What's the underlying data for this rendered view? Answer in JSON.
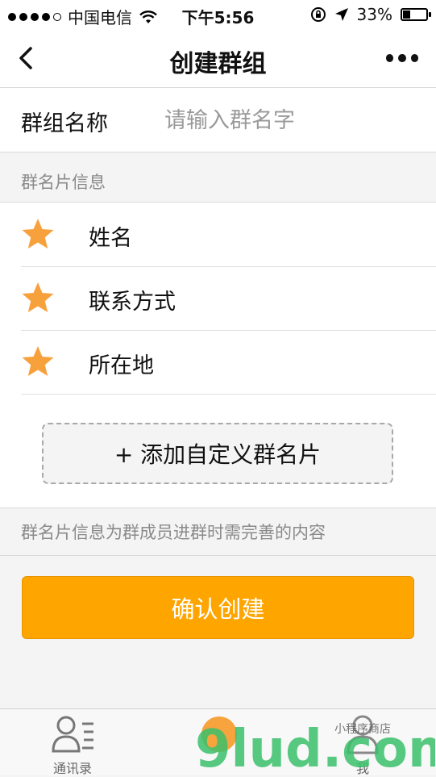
{
  "status_bar": {
    "carrier": "中国电信",
    "time": "下午5:56",
    "battery_percent": "33%",
    "battery_level": 0.33
  },
  "nav": {
    "title": "创建群组"
  },
  "group_name": {
    "label": "群组名称",
    "placeholder": "请输入群名字",
    "value": ""
  },
  "card_section": {
    "header": "群名片信息",
    "fields": [
      {
        "label": "姓名"
      },
      {
        "label": "联系方式"
      },
      {
        "label": "所在地"
      }
    ],
    "add_button": "+ 添加自定义群名片",
    "hint": "群名片信息为群成员进群时需完善的内容"
  },
  "confirm_button": "确认创建",
  "tabbar": {
    "items": [
      {
        "label": "通讯录"
      },
      {
        "label": "我"
      }
    ]
  },
  "colors": {
    "accent": "#ffa500",
    "star": "#f7a13d"
  },
  "watermark": {
    "text": "9lud.com",
    "subtext": "小程序商店"
  }
}
